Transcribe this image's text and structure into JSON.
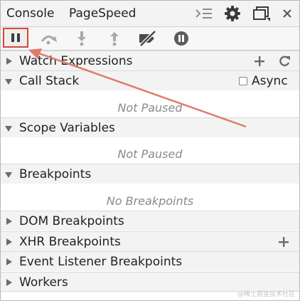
{
  "tabs": {
    "console": "Console",
    "pagespeed": "PageSpeed"
  },
  "tabbar_icons": [
    "drawer-toggle-icon",
    "gear-icon",
    "dock-side-icon",
    "close-icon"
  ],
  "toolbar_icons": [
    "pause-icon",
    "step-over-icon",
    "step-into-icon",
    "step-out-icon",
    "deactivate-breakpoints-icon",
    "pause-on-exceptions-icon"
  ],
  "sections": {
    "watch": {
      "label": "Watch Expressions"
    },
    "callstack": {
      "label": "Call Stack",
      "async_label": "Async",
      "empty": "Not Paused"
    },
    "scope": {
      "label": "Scope Variables",
      "empty": "Not Paused"
    },
    "breakpoints": {
      "label": "Breakpoints",
      "empty": "No Breakpoints"
    },
    "dom": {
      "label": "DOM Breakpoints"
    },
    "xhr": {
      "label": "XHR Breakpoints"
    },
    "event": {
      "label": "Event Listener Breakpoints"
    },
    "workers": {
      "label": "Workers"
    }
  },
  "watermark": "@稀土掘金技术社区",
  "colors": {
    "highlight": "#d8453a",
    "arrow": "#e07a6c",
    "pause_on_exceptions": "#6b6b6b"
  }
}
